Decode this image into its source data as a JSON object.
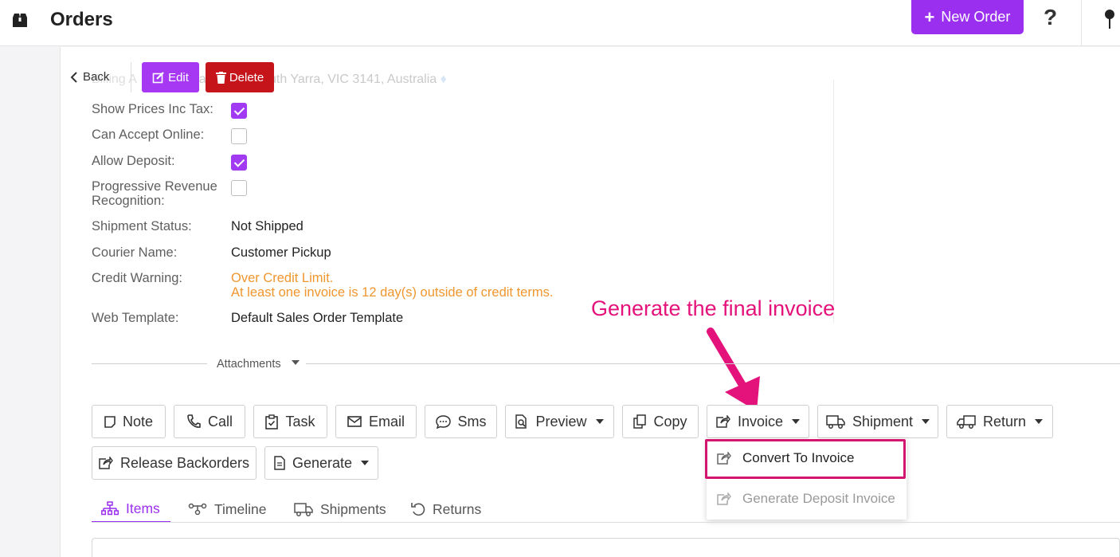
{
  "header": {
    "title": "Orders",
    "new_order_label": "New Order",
    "help_symbol": "?",
    "brand_color": "#9b2ff0"
  },
  "nav": {
    "back_label": "Back",
    "edit_label": "Edit",
    "delete_label": "Delete",
    "delete_color": "#c5151b"
  },
  "address": {
    "ghost_prefix": "Billing A",
    "ghost_text": "ak Road, South Yarra, VIC 3141, Australia"
  },
  "details": {
    "show_prices_inc_tax": {
      "label": "Show Prices Inc Tax:",
      "checked": true
    },
    "can_accept_online": {
      "label": "Can Accept Online:",
      "checked": false
    },
    "allow_deposit": {
      "label": "Allow Deposit:",
      "checked": true
    },
    "progressive_revenue": {
      "label": "Progressive Revenue Recognition:",
      "checked": false
    },
    "shipment_status": {
      "label": "Shipment Status:",
      "value": "Not Shipped"
    },
    "courier_name": {
      "label": "Courier Name:",
      "value": "Customer Pickup"
    },
    "credit_warning": {
      "label": "Credit Warning:",
      "line1": "Over Credit Limit.",
      "line2": "At least one invoice is 12 day(s) outside of credit terms.",
      "color": "#f0962e"
    },
    "web_template": {
      "label": "Web Template:",
      "value": "Default Sales Order Template"
    }
  },
  "attachments": {
    "label": "Attachments"
  },
  "actions": {
    "note": "Note",
    "call": "Call",
    "task": "Task",
    "email": "Email",
    "sms": "Sms",
    "preview": "Preview",
    "copy": "Copy",
    "invoice": "Invoice",
    "shipment": "Shipment",
    "return": "Return",
    "release_backorders": "Release Backorders",
    "generate": "Generate"
  },
  "invoice_menu": {
    "convert": "Convert To Invoice",
    "generate_deposit": "Generate Deposit Invoice"
  },
  "annotation": {
    "text": "Generate the final invoice",
    "color": "#e4137b"
  },
  "tabs": {
    "items": "Items",
    "timeline": "Timeline",
    "shipments": "Shipments",
    "returns": "Returns",
    "active": "Items"
  }
}
